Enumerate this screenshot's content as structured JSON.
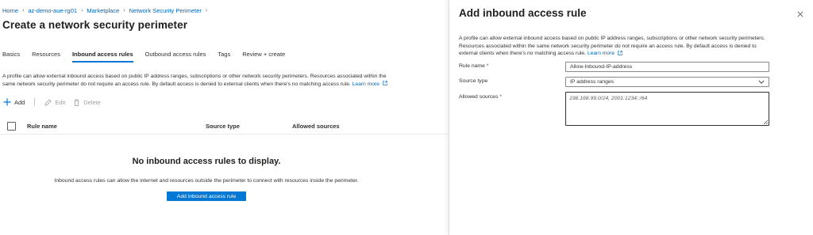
{
  "breadcrumb": {
    "items": [
      "Home",
      "az-demo-aue-rg01",
      "Marketplace",
      "Network Security Perimeter"
    ]
  },
  "page": {
    "title": "Create a network security perimeter",
    "more": "···"
  },
  "tabs": [
    {
      "label": "Basics",
      "active": false
    },
    {
      "label": "Resources",
      "active": false
    },
    {
      "label": "Inbound access rules",
      "active": true
    },
    {
      "label": "Outbound access rules",
      "active": false
    },
    {
      "label": "Tags",
      "active": false
    },
    {
      "label": "Review + create",
      "active": false
    }
  ],
  "description": {
    "text": "A profile can allow external inbound access based on public IP address ranges, subscriptions or other network security perimeters. Resources associated within the same network security perimeter do not require an access rule. By default access is denied to external clients when there's no matching access rule.",
    "link": "Learn more"
  },
  "toolbar": {
    "add": "Add",
    "edit": "Edit",
    "delete": "Delete"
  },
  "table": {
    "columns": [
      "Rule name",
      "Source type",
      "Allowed sources"
    ],
    "rows": []
  },
  "empty_state": {
    "title": "No inbound access rules to display.",
    "subtitle": "Inbound access rules can allow the internet and resources outside the perimeter to connect with resources inside the perimeter.",
    "button": "Add inbound access rule"
  },
  "panel": {
    "title": "Add inbound access rule",
    "description": "A profile can allow external inbound access based on public IP address ranges, subscriptions or other network security perimeters. Resources associated within the same network security perimeter do not require an access rule. By default access is denied to external clients when there's no matching access rule.",
    "link": "Learn more",
    "rule_name_label": "Rule name",
    "rule_name_value": "Allow-Inbound-IP-address",
    "source_type_label": "Source type",
    "source_type_value": "IP address ranges",
    "allowed_sources_label": "Allowed sources",
    "allowed_sources_placeholder": "198.168.99.0/24, 2001:1234::/64",
    "required_marker": "*"
  },
  "colors": {
    "accent": "#0078d4",
    "link": "#0067b8",
    "required": "#a4262c"
  }
}
